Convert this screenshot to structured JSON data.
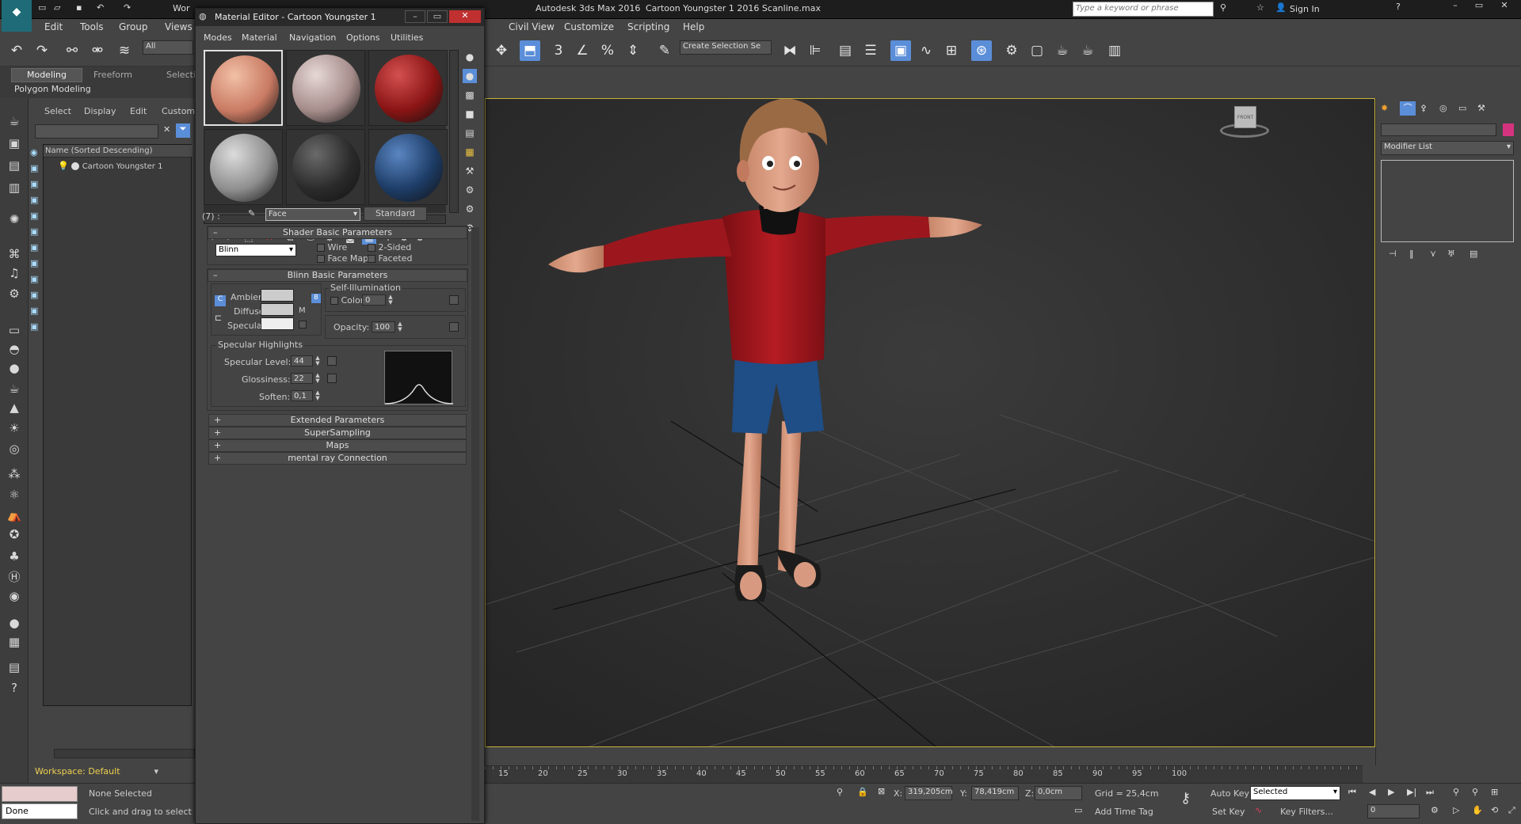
{
  "app": {
    "title": "Autodesk 3ds Max 2016",
    "file": "Cartoon Youngster 1 2016 Scanline.max",
    "search_placeholder": "Type a keyword or phrase",
    "sign_in": "Sign In",
    "workspace_partial": "Wor"
  },
  "menu": [
    "Edit",
    "Tools",
    "Group",
    "Views",
    "Civil View",
    "Customize",
    "Scripting",
    "Help"
  ],
  "toolbar": {
    "filter": "All",
    "selection_set": "Create Selection Se"
  },
  "ribbon": {
    "tabs": [
      "Modeling",
      "Freeform",
      "Selecti"
    ],
    "sub": "Polygon Modeling"
  },
  "scene_explorer": {
    "tabs": [
      "Select",
      "Display",
      "Edit",
      "Custom"
    ],
    "header": "Name (Sorted Descending)",
    "items": [
      "Cartoon Youngster 1"
    ]
  },
  "material_editor": {
    "title": "Material Editor - Cartoon Youngster 1",
    "menu": [
      "Modes",
      "Material",
      "Navigation",
      "Options",
      "Utilities"
    ],
    "swatches": [
      {
        "name": "skin",
        "color": "#c97a63",
        "hi": "#f1c0a6"
      },
      {
        "name": "eye",
        "color": "#a68d8b",
        "hi": "#e6d8d6"
      },
      {
        "name": "shirt",
        "color": "#8a1414",
        "hi": "#d35050"
      },
      {
        "name": "grey",
        "color": "#8e8e8e",
        "hi": "#dcdcdc"
      },
      {
        "name": "black",
        "color": "#2a2a2a",
        "hi": "#6a6a6a"
      },
      {
        "name": "shorts",
        "color": "#1d3c66",
        "hi": "#5a86c2"
      }
    ],
    "slot_count": "(7) :",
    "material_name": "Face",
    "material_type": "Standard",
    "shader_rollout": "Shader Basic Parameters",
    "shader": "Blinn",
    "options": [
      "Wire",
      "2-Sided",
      "Face Map",
      "Faceted"
    ],
    "blinn_rollout": "Blinn Basic Parameters",
    "self_illum_label": "Self-Illumination",
    "color_label": "Color",
    "color_value": "0",
    "ambient_label": "Ambient:",
    "diffuse_label": "Diffuse:",
    "specular_label": "Specular:",
    "map_m": "M",
    "opacity_label": "Opacity:",
    "opacity_value": "100",
    "spec_group": "Specular Highlights",
    "spec_level_label": "Specular Level:",
    "spec_level_value": "44",
    "gloss_label": "Glossiness:",
    "gloss_value": "22",
    "soften_label": "Soften:",
    "soften_value": "0,1",
    "rollouts": [
      "Extended Parameters",
      "SuperSampling",
      "Maps",
      "mental ray Connection"
    ]
  },
  "command_panel": {
    "modifier_list": "Modifier List",
    "accent": "#d6337f"
  },
  "timeline": {
    "ticks": [
      "15",
      "20",
      "25",
      "30",
      "35",
      "40",
      "45",
      "50",
      "55",
      "60",
      "65",
      "70",
      "75",
      "80",
      "85",
      "90",
      "95",
      "100"
    ]
  },
  "status": {
    "workspace": "Workspace: Default",
    "done": "Done",
    "selection": "None Selected",
    "prompt": "Click and drag to select an",
    "x_label": "X:",
    "x": "319,205cm",
    "y_label": "Y:",
    "y": "78,419cm",
    "z_label": "Z:",
    "z": "0,0cm",
    "grid": "Grid = 25,4cm",
    "add_time_tag": "Add Time Tag",
    "auto_key": "Auto Key",
    "set_key": "Set Key",
    "key_mode": "Selected",
    "key_filters": "Key Filters...",
    "frame": "0"
  },
  "viewport": {
    "cube_label": "FRONT",
    "shirt": "#a8151b",
    "shorts": "#1f4d86",
    "skin": "#dc9b82",
    "hair": "#9a6a44"
  }
}
